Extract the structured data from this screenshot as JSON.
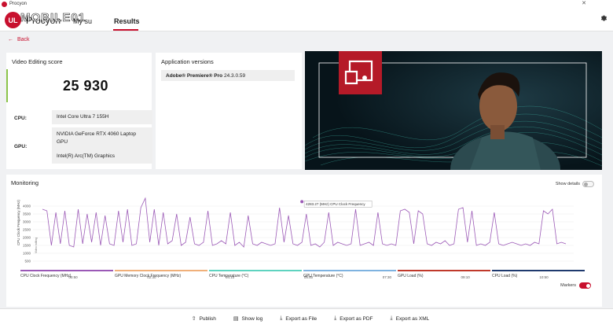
{
  "window": {
    "title": "Procyon",
    "close_glyph": "✕"
  },
  "nav": {
    "brand": "Procyon",
    "watermark": "MOBILE01",
    "logo_text": "UL",
    "tabs": [
      {
        "label": "My su"
      },
      {
        "label": "Results"
      }
    ],
    "active_tab": "Results",
    "settings_icon": "gear-icon"
  },
  "back": {
    "label": "Back"
  },
  "score": {
    "title": "Video Editing score",
    "value": "25 930",
    "cpu_label": "CPU:",
    "cpu_value": "Intel Core Ultra 7 155H",
    "gpu_label": "GPU:",
    "gpu_value_1": "NVIDIA GeForce RTX 4060 Laptop GPU",
    "gpu_value_2": "Intel(R) Arc(TM) Graphics",
    "accent": "#8bc34a"
  },
  "apps": {
    "title": "Application versions",
    "items": [
      {
        "name": "Adobe® Premiere® Pro",
        "version": "24.3.0.59"
      }
    ]
  },
  "monitoring": {
    "title": "Monitoring",
    "show_details_label": "Show details",
    "show_details_on": false,
    "markers_label": "Markers",
    "markers_on": true,
    "y_axis_label": "CPU Clock Frequency (MHz)",
    "phase_label": "Video editing",
    "tooltip": "4283.27 (MHz) CPU Clock Frequency",
    "legend": [
      {
        "label": "CPU Clock Frequency (MHz)",
        "color": "#9b59b6"
      },
      {
        "label": "GPU Memory Clock Frequency (MHz)",
        "color": "#f0b07a"
      },
      {
        "label": "CPU Temperature (°C)",
        "color": "#5fd3c0"
      },
      {
        "label": "GPU Temperature (°C)",
        "color": "#7fb3e0"
      },
      {
        "label": "GPU Load (%)",
        "color": "#c0392b"
      },
      {
        "label": "CPU Load (%)",
        "color": "#1f3a6e"
      }
    ]
  },
  "chart_data": {
    "type": "line",
    "ylabel": "CPU Clock Frequency (MHz)",
    "yticks": [
      500,
      1000,
      1500,
      2000,
      2500,
      3000,
      3500,
      4000
    ],
    "ylim": [
      0,
      4800
    ],
    "xticks": [
      "00:50",
      "02:30",
      "04:10",
      "05:50",
      "07:30",
      "09:10",
      "10:50"
    ],
    "grid": true,
    "series": [
      {
        "name": "CPU Clock Frequency (MHz)",
        "values": [
          3800,
          3700,
          1500,
          3600,
          1600,
          3700,
          1500,
          1400,
          3800,
          1600,
          3500,
          1700,
          3600,
          1500,
          3400,
          1600,
          1500,
          3700,
          1700,
          3800,
          1500,
          1600,
          3900,
          4500,
          1700,
          3800,
          1500,
          3600,
          1600,
          1800,
          3500,
          1500,
          1700,
          3300,
          1600,
          1500,
          1700,
          3700,
          1500,
          1600,
          1800,
          1600,
          3600,
          1500,
          1700,
          1400,
          3400,
          1600,
          1500,
          1700,
          1600,
          1500,
          1600,
          3900,
          1700,
          3400,
          1600,
          1500,
          1700,
          3500,
          1500,
          1600,
          1400,
          1700,
          3600,
          1500,
          1700,
          1600,
          1500,
          1600,
          3800,
          1500,
          1600,
          1700,
          1500,
          3600,
          1600,
          1500,
          1600,
          1500,
          3700,
          3800,
          3600,
          1600,
          3700,
          3500,
          1600,
          1500,
          1700,
          1600,
          1800,
          1500,
          1600,
          3800,
          3900,
          1700,
          3700,
          1500,
          1600,
          1500,
          1700,
          3600,
          1600,
          1500,
          1600,
          1700,
          1600,
          1500,
          1600,
          1500,
          1700,
          1600,
          3700,
          3500,
          3800,
          1600,
          1700,
          1600
        ]
      }
    ]
  },
  "actions": [
    {
      "label": "Publish",
      "icon": "upload-icon"
    },
    {
      "label": "Show log",
      "icon": "document-icon"
    },
    {
      "label": "Export as File",
      "icon": "download-icon"
    },
    {
      "label": "Export as PDF",
      "icon": "download-icon"
    },
    {
      "label": "Export as XML",
      "icon": "download-icon"
    }
  ]
}
